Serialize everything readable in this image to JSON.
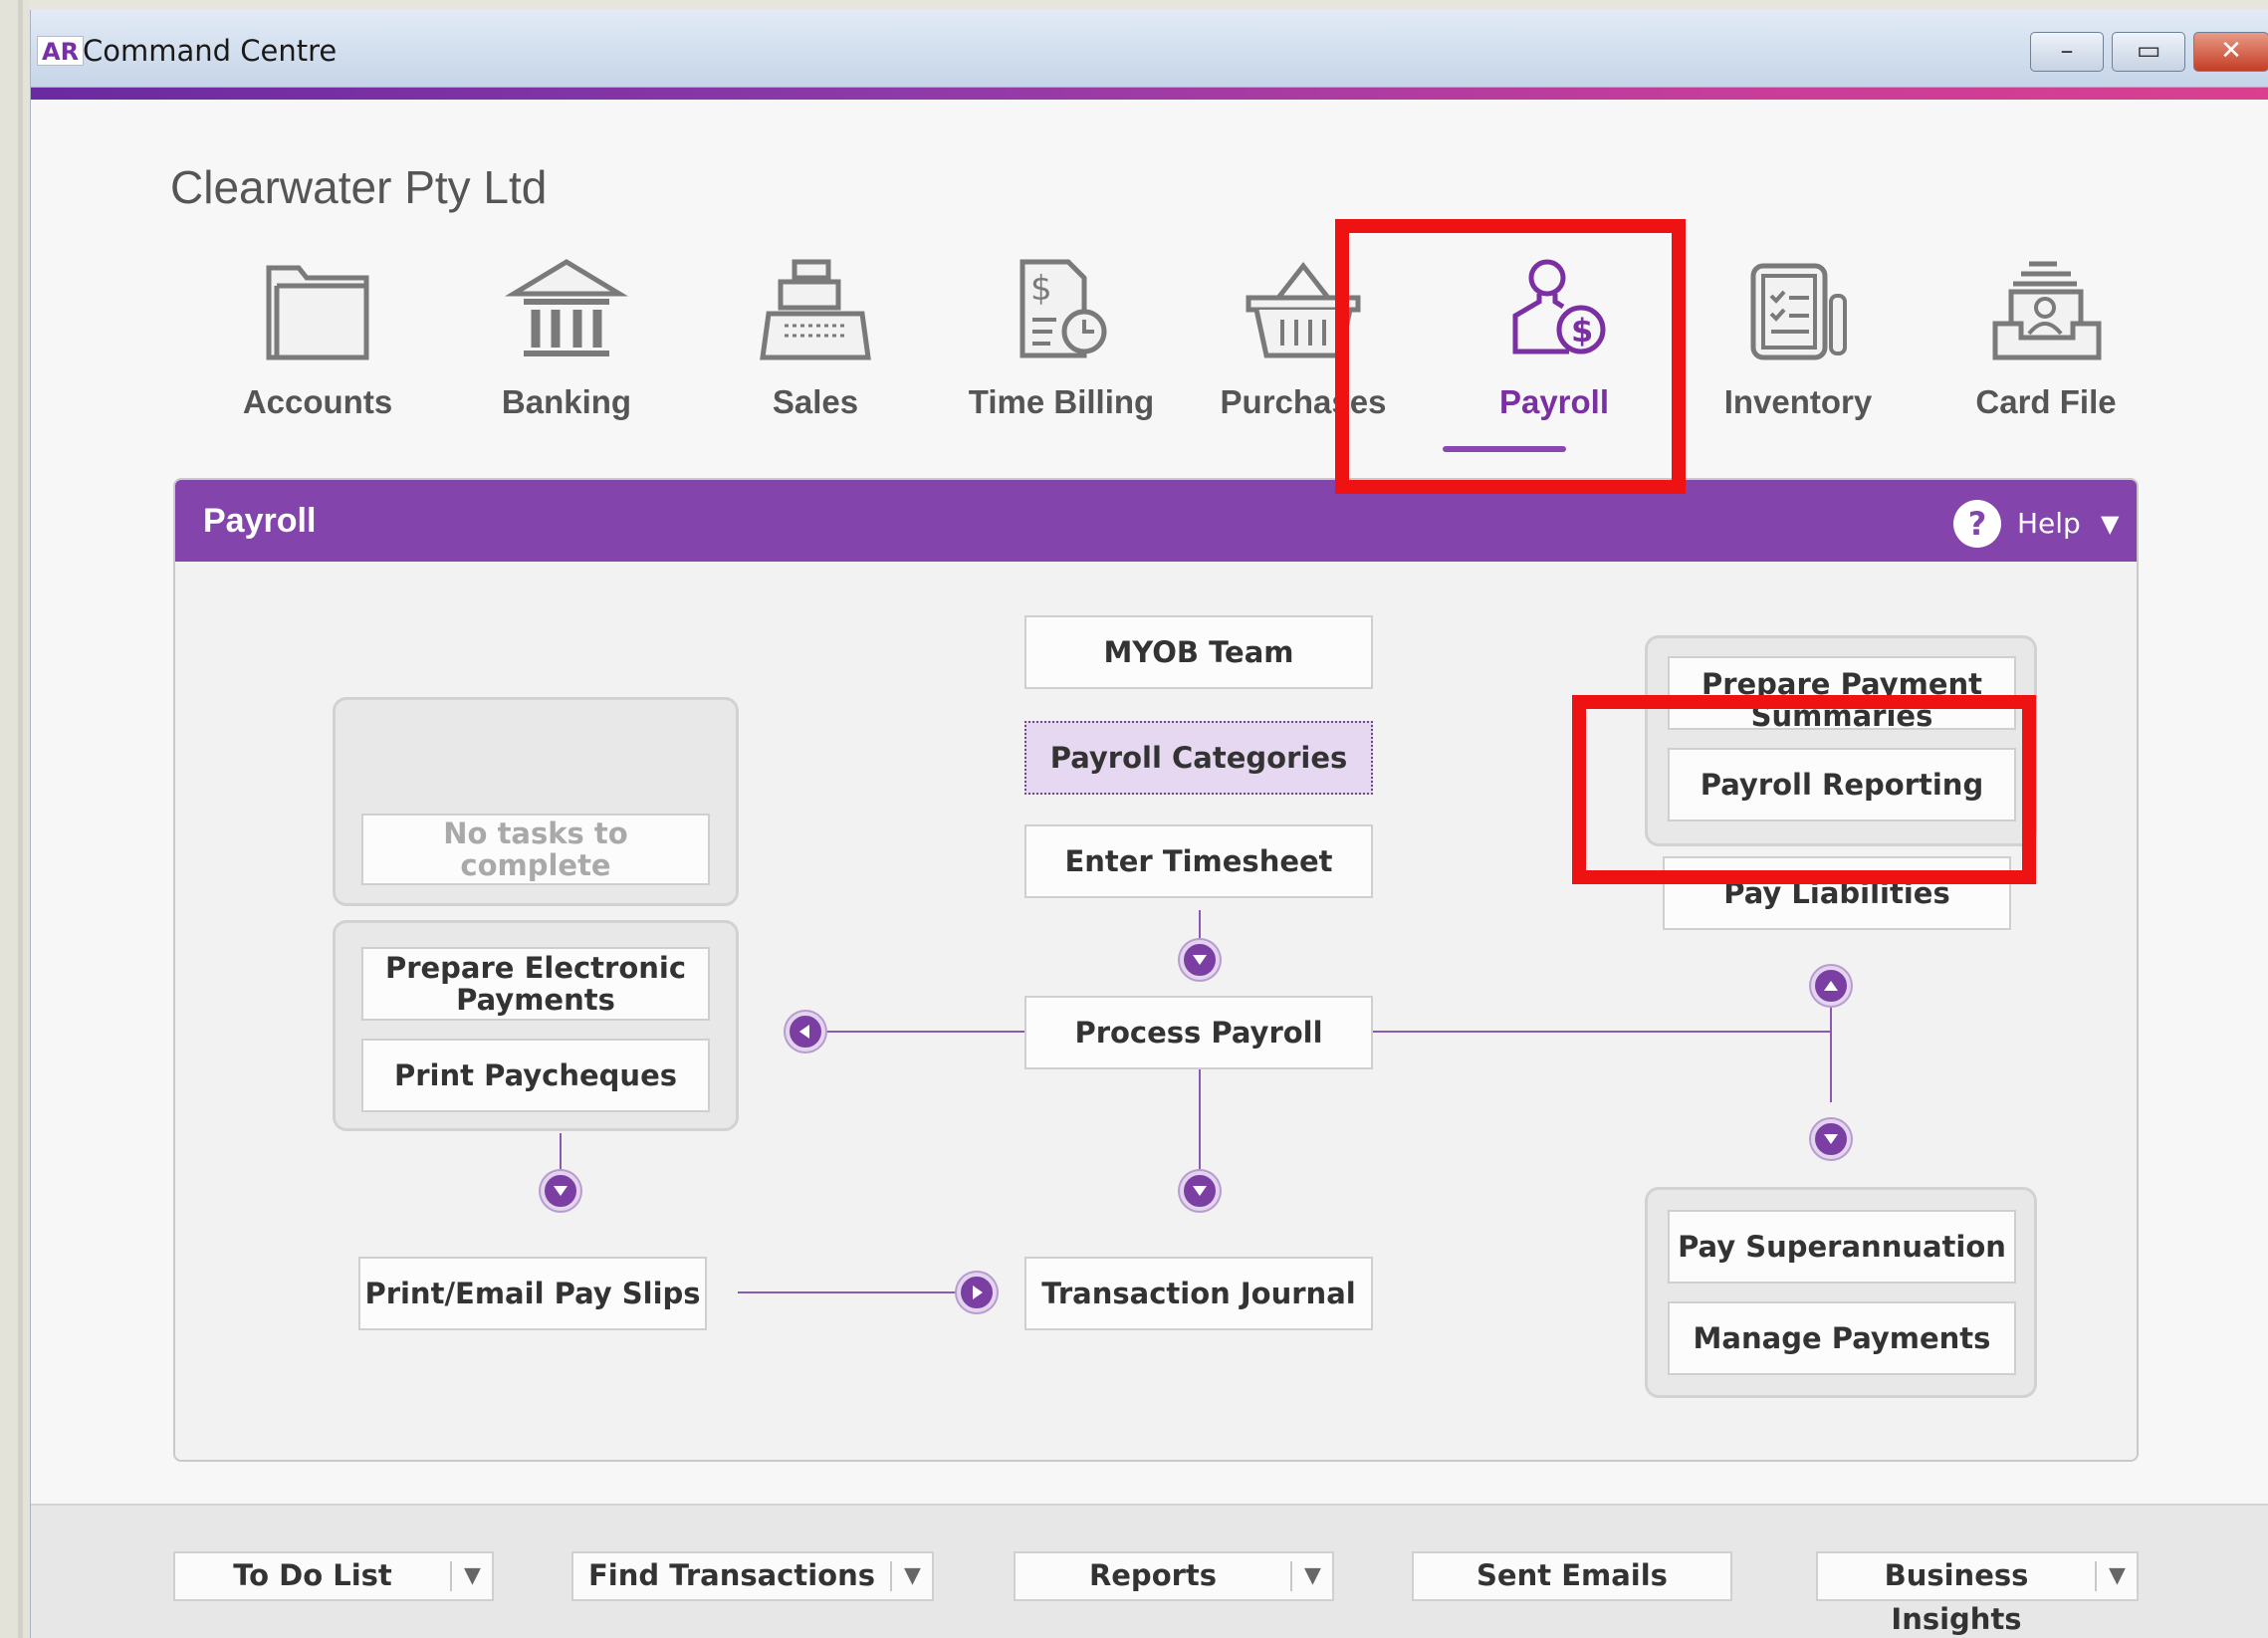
{
  "window": {
    "logo": "AR",
    "title": "Command Centre",
    "controls": [
      "–",
      "▭",
      "✕"
    ]
  },
  "company": "Clearwater Pty Ltd",
  "nav": [
    {
      "label": "Accounts",
      "icon": "folder-icon"
    },
    {
      "label": "Banking",
      "icon": "bank-icon"
    },
    {
      "label": "Sales",
      "icon": "cash-register-icon"
    },
    {
      "label": "Time Billing",
      "icon": "time-billing-icon"
    },
    {
      "label": "Purchases",
      "icon": "basket-icon"
    },
    {
      "label": "Payroll",
      "icon": "payroll-person-dollar-icon",
      "active": true
    },
    {
      "label": "Inventory",
      "icon": "inventory-clipboard-icon"
    },
    {
      "label": "Card File",
      "icon": "card-file-icon"
    }
  ],
  "panel": {
    "title": "Payroll",
    "help_label": "Help",
    "help_icon": "question-circle-icon",
    "caret_icon": "caret-down-icon"
  },
  "tasks": {
    "no_tasks": "No tasks to complete",
    "prepare_electronic_payments": "Prepare Electronic Payments",
    "print_paycheques": "Print Paycheques",
    "print_email_pay_slips": "Print/Email Pay Slips",
    "myob_team": "MYOB Team",
    "payroll_categories": "Payroll Categories",
    "enter_timesheet": "Enter Timesheet",
    "process_payroll": "Process Payroll",
    "transaction_journal": "Transaction Journal",
    "prepare_payment_summaries": "Prepare Payment Summaries",
    "payroll_reporting": "Payroll Reporting",
    "pay_liabilities": "Pay Liabilities",
    "pay_superannuation": "Pay Superannuation",
    "manage_payments": "Manage Payments"
  },
  "footer": {
    "to_do_list": "To Do List",
    "find_transactions": "Find Transactions",
    "reports": "Reports",
    "sent_emails": "Sent Emails",
    "business_insights": "Business Insights"
  },
  "colors": {
    "accent_purple": "#8345ab",
    "highlight_red": "#ee1212"
  }
}
